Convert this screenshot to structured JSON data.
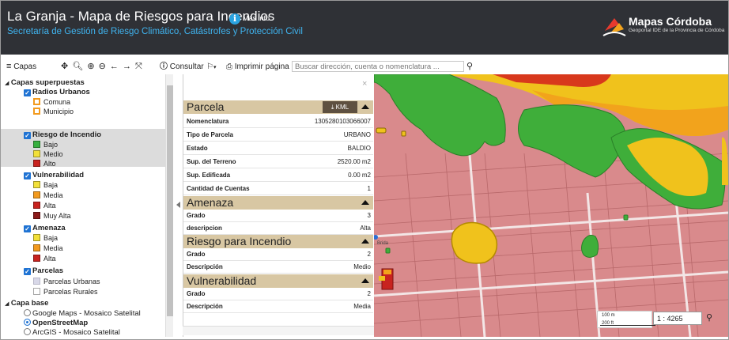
{
  "header": {
    "title": "La Granja - Mapa de Riesgos para Incendios",
    "info_icon": "i",
    "info_link": "Más info",
    "subtitle": "Secretaría de Gestión de Riesgo Climático, Catástrofes y Protección Civil",
    "brand_name": "Mapas Córdoba",
    "brand_tagline": "Geoportal IDE de la Provincia de Córdoba"
  },
  "toolbar": {
    "capas_icon": "hamburger-icon",
    "capas_label": "Capas",
    "tools": "✥ 🔍︎ ⊕ ⊖ ← → ⤧",
    "consultar_label": "Consultar",
    "print_label": "Imprimir página",
    "search_placeholder": "Buscar dirección, cuenta o nomenclatura ...",
    "search_icon": "magnifier-icon"
  },
  "layers": {
    "group_overlays": "Capas superpuestas",
    "radios_urbanos": "Radios Urbanos",
    "comuna": "Comuna",
    "municipio": "Municipio",
    "riesgo_incendio": "Riesgo de Incendio",
    "bajo": "Bajo",
    "medio": "Medio",
    "alto": "Alto",
    "vulnerabilidad": "Vulnerabilidad",
    "muy_alta": "Muy Alta",
    "baja": "Baja",
    "media": "Media",
    "alta": "Alta",
    "amenaza": "Amenaza",
    "parcelas": "Parcelas",
    "parcelas_urbanas": "Parcelas Urbanas",
    "parcelas_rurales": "Parcelas Rurales",
    "group_base": "Capa base",
    "google": "Google Maps - Mosaico Satelital",
    "osm": "OpenStreetMap",
    "arcgis": "ArcGIS - Mosaico Satelital"
  },
  "info": {
    "close": "×",
    "kml_label": "KML",
    "parcela": {
      "title": "Parcela",
      "rows": [
        {
          "k": "Nomenclatura",
          "v": "1305280103066007"
        },
        {
          "k": "Tipo de Parcela",
          "v": "URBANO"
        },
        {
          "k": "Estado",
          "v": "BALDIO"
        },
        {
          "k": "Sup. del Terreno",
          "v": "2520.00 m2"
        },
        {
          "k": "Sup. Edificada",
          "v": "0.00 m2"
        },
        {
          "k": "Cantidad de Cuentas",
          "v": "1"
        }
      ]
    },
    "amenaza": {
      "title": "Amenaza",
      "rows": [
        {
          "k": "Grado",
          "v": "3"
        },
        {
          "k": "descripcion",
          "v": "Alta"
        }
      ]
    },
    "riesgo": {
      "title": "Riesgo para Incendio",
      "rows": [
        {
          "k": "Grado",
          "v": "2"
        },
        {
          "k": "Descripción",
          "v": "Medio"
        }
      ]
    },
    "vulnerabilidad": {
      "title": "Vulnerabilidad",
      "rows": [
        {
          "k": "Grado",
          "v": "2"
        },
        {
          "k": "Descripción",
          "v": "Media"
        }
      ]
    }
  },
  "map": {
    "scale_100": "100 m",
    "scale_200": "200 ft",
    "ratio": "1 : 4265",
    "street_label": "Brida"
  },
  "colors": {
    "bajo": "#38b040",
    "medio": "#f2e03a",
    "alto": "#c8231f",
    "muy_alta": "#8b1a1a",
    "amenaza_media": "#f29a1e",
    "comuna": "#f29a1e",
    "municipio": "#f29a1e",
    "parcelas_urbanas": "#d8d8e8"
  }
}
